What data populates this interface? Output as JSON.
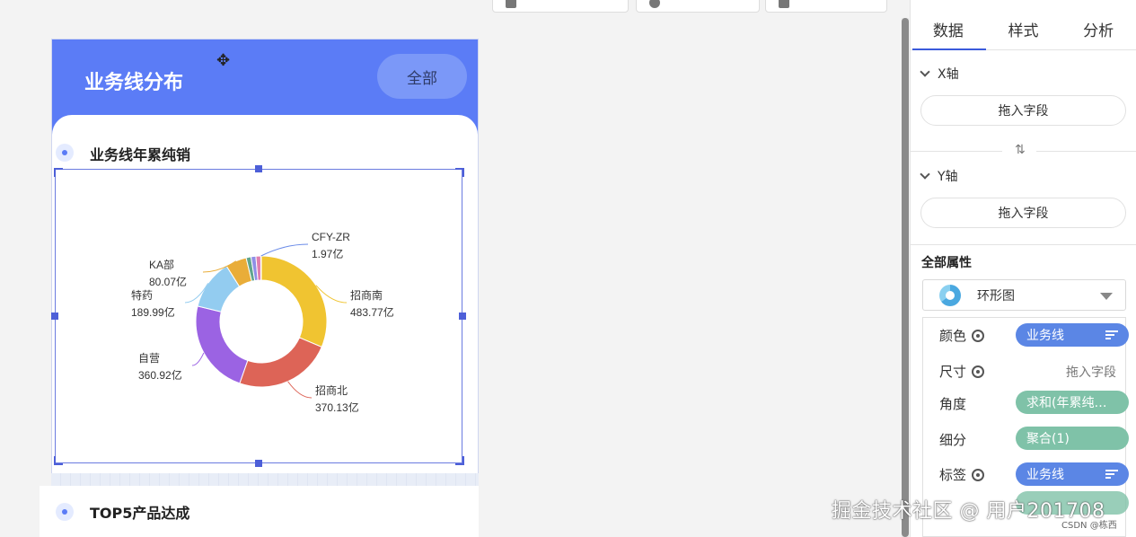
{
  "card": {
    "title": "业务线分布",
    "filter_button": "全部",
    "section1_title": "业务线年累纯销",
    "section2_title": "TOP5产品达成"
  },
  "chart_data": {
    "type": "pie",
    "variant": "donut",
    "title": "",
    "unit": "亿",
    "categories": [
      "招商南",
      "招商北",
      "自营",
      "特药",
      "KA部",
      "CFY-ZR"
    ],
    "values": [
      483.77,
      370.13,
      360.92,
      189.99,
      80.07,
      1.97
    ],
    "labels": [
      {
        "name": "招商南",
        "value": "483.77亿"
      },
      {
        "name": "招商北",
        "value": "370.13亿"
      },
      {
        "name": "自营",
        "value": "360.92亿"
      },
      {
        "name": "特药",
        "value": "189.99亿"
      },
      {
        "name": "KA部",
        "value": "80.07亿"
      },
      {
        "name": "CFY-ZR",
        "value": "1.97亿"
      }
    ],
    "colors": [
      "#f0c431",
      "#dd6457",
      "#9b63e3",
      "#93ccf0",
      "#e9ad39",
      "#1f3c73"
    ],
    "small_slice_colors": [
      "#5fa58c",
      "#8f8fe6",
      "#e07fb0"
    ],
    "legend": "none",
    "labels_position": "outside"
  },
  "panel": {
    "tabs": [
      "数据",
      "样式",
      "分析"
    ],
    "active_tab": "数据",
    "x_axis_label": "X轴",
    "y_axis_label": "Y轴",
    "drop_placeholder": "拖入字段",
    "all_props_label": "全部属性",
    "chart_type": "环形图",
    "marks": {
      "color_label": "颜色",
      "color_value": "业务线",
      "size_label": "尺寸",
      "size_value": "拖入字段",
      "angle_label": "角度",
      "angle_value": "求和(年累纯…",
      "detail_label": "细分",
      "detail_value": "聚合(1)",
      "tag_label": "标签",
      "tag_value": "业务线"
    }
  },
  "watermark": {
    "main": "掘金技术社区 @ 用户201708",
    "small": "CSDN @栋西"
  }
}
